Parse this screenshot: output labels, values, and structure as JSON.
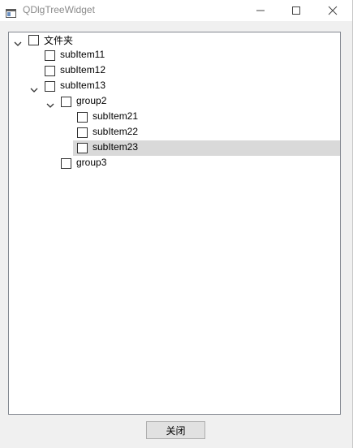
{
  "window": {
    "title": "QDlgTreeWidget",
    "controls": [
      "minimize-icon",
      "maximize-icon",
      "close-icon"
    ]
  },
  "tree": {
    "items": [
      {
        "label": "文件夹",
        "level": 0,
        "expanded": true,
        "checked": false
      },
      {
        "label": "subItem11",
        "level": 1,
        "checked": false
      },
      {
        "label": "subItem12",
        "level": 1,
        "checked": false
      },
      {
        "label": "subItem13",
        "level": 1,
        "expanded": true,
        "checked": false
      },
      {
        "label": "group2",
        "level": 2,
        "expanded": true,
        "checked": false
      },
      {
        "label": "subItem21",
        "level": 3,
        "checked": false
      },
      {
        "label": "subItem22",
        "level": 3,
        "checked": false
      },
      {
        "label": "subItem23",
        "level": 3,
        "checked": false,
        "selected": true
      },
      {
        "label": "group3",
        "level": 2,
        "checked": false
      }
    ],
    "selection_color": "#d9d9d9"
  },
  "footer": {
    "close_label": "关闭"
  }
}
